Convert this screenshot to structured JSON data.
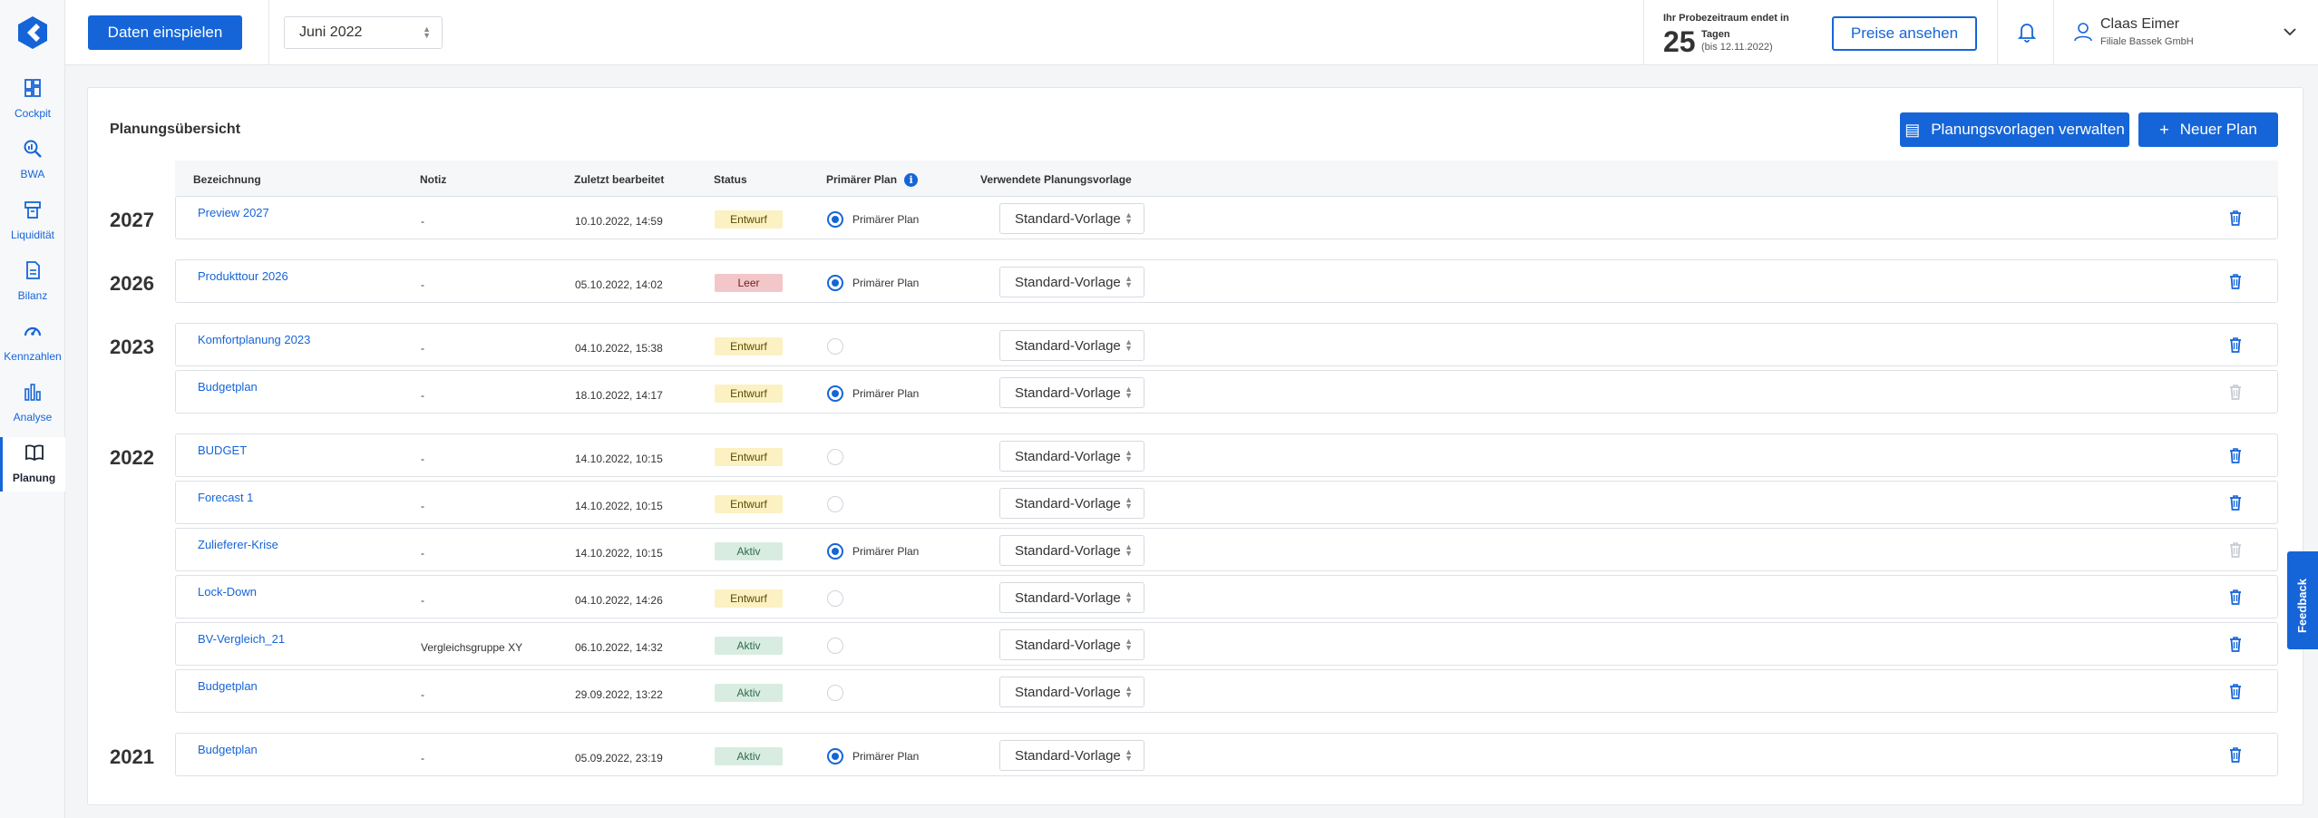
{
  "sidebar": {
    "items": [
      {
        "label": "Cockpit",
        "icon": "layout-icon"
      },
      {
        "label": "BWA",
        "icon": "search-chart-icon"
      },
      {
        "label": "Liquidität",
        "icon": "cash-icon"
      },
      {
        "label": "Bilanz",
        "icon": "document-icon"
      },
      {
        "label": "Kennzahlen",
        "icon": "gauge-icon"
      },
      {
        "label": "Analyse",
        "icon": "bar-chart-icon"
      },
      {
        "label": "Planung",
        "icon": "book-icon",
        "active": true
      }
    ]
  },
  "topbar": {
    "import_button": "Daten einspielen",
    "month_value": "Juni 2022",
    "trial_line1": "Ihr Probezeitraum endet in",
    "trial_days": "25",
    "trial_days_label": "Tagen",
    "trial_date": "(bis 12.11.2022)",
    "prices_button": "Preise ansehen",
    "user_name": "Claas Eimer",
    "user_company": "Filiale Bassek GmbH"
  },
  "main": {
    "title": "Planungsübersicht",
    "templates_button": "Planungsvorlagen verwalten",
    "new_plan_button": "Neuer Plan",
    "columns": [
      "Bezeichnung",
      "Notiz",
      "Zuletzt bearbeitet",
      "Status",
      "Primärer Plan",
      "Verwendete Planungsvorlage"
    ],
    "years": [
      "2027",
      "2026",
      "2023",
      "2022",
      "2021"
    ],
    "rows": [
      {
        "name": "Preview 2027",
        "note": "-",
        "edited": "10.10.2022, 14:59",
        "status": "Entwurf",
        "primary": true,
        "primary_label": "Primärer Plan",
        "template": "Standard-Vorlage",
        "deletable": true
      },
      {
        "name": "Produkttour 2026",
        "note": "-",
        "edited": "05.10.2022, 14:02",
        "status": "Leer",
        "primary": true,
        "primary_label": "Primärer Plan",
        "template": "Standard-Vorlage",
        "deletable": true
      },
      {
        "name": "Komfortplanung 2023",
        "note": "-",
        "edited": "04.10.2022, 15:38",
        "status": "Entwurf",
        "primary": false,
        "primary_label": "",
        "template": "Standard-Vorlage",
        "deletable": true
      },
      {
        "name": "Budgetplan",
        "note": "-",
        "edited": "18.10.2022, 14:17",
        "status": "Entwurf",
        "primary": true,
        "primary_label": "Primärer Plan",
        "template": "Standard-Vorlage",
        "deletable": false
      },
      {
        "name": "BUDGET",
        "note": "-",
        "edited": "14.10.2022, 10:15",
        "status": "Entwurf",
        "primary": false,
        "primary_label": "",
        "template": "Standard-Vorlage",
        "deletable": true
      },
      {
        "name": "Forecast 1",
        "note": "-",
        "edited": "14.10.2022, 10:15",
        "status": "Entwurf",
        "primary": false,
        "primary_label": "",
        "template": "Standard-Vorlage",
        "deletable": true
      },
      {
        "name": "Zulieferer-Krise",
        "note": "-",
        "edited": "14.10.2022, 10:15",
        "status": "Aktiv",
        "primary": true,
        "primary_label": "Primärer Plan",
        "template": "Standard-Vorlage",
        "deletable": false
      },
      {
        "name": "Lock-Down",
        "note": "-",
        "edited": "04.10.2022, 14:26",
        "status": "Entwurf",
        "primary": false,
        "primary_label": "",
        "template": "Standard-Vorlage",
        "deletable": true
      },
      {
        "name": "BV-Vergleich_21",
        "note": "Vergleichsgruppe XY",
        "edited": "06.10.2022, 14:32",
        "status": "Aktiv",
        "primary": false,
        "primary_label": "",
        "template": "Standard-Vorlage",
        "deletable": true
      },
      {
        "name": "Budgetplan",
        "note": "-",
        "edited": "29.09.2022, 13:22",
        "status": "Aktiv",
        "primary": false,
        "primary_label": "",
        "template": "Standard-Vorlage",
        "deletable": true
      },
      {
        "name": "Budgetplan",
        "note": "-",
        "edited": "05.09.2022, 23:19",
        "status": "Aktiv",
        "primary": true,
        "primary_label": "Primärer Plan",
        "template": "Standard-Vorlage",
        "deletable": true
      }
    ]
  },
  "feedback_label": "Feedback",
  "colors": {
    "accent": "#1565d8",
    "entwurf": "#fbf1c2",
    "leer": "#f3c7c9",
    "aktiv": "#d9ece2"
  }
}
